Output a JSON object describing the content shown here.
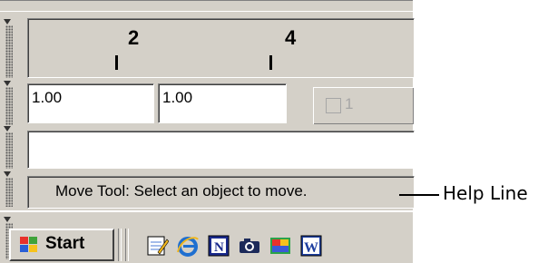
{
  "ruler": {
    "marks": [
      "2",
      "4"
    ]
  },
  "fields": {
    "width_value": "1.00",
    "height_value": "1.00",
    "disabled_count": "1"
  },
  "status": {
    "message": "Move Tool: Select an object to move."
  },
  "callout": {
    "label": "Help Line"
  },
  "taskbar": {
    "start_label": "Start",
    "quick_launch": [
      "notepad-icon",
      "internet-explorer-icon",
      "n-app-icon",
      "camera-icon",
      "paint-app-icon",
      "word-icon"
    ]
  },
  "colors": {
    "face": "#d4d0c8",
    "shadow": "#808080",
    "highlight": "#ffffff"
  }
}
